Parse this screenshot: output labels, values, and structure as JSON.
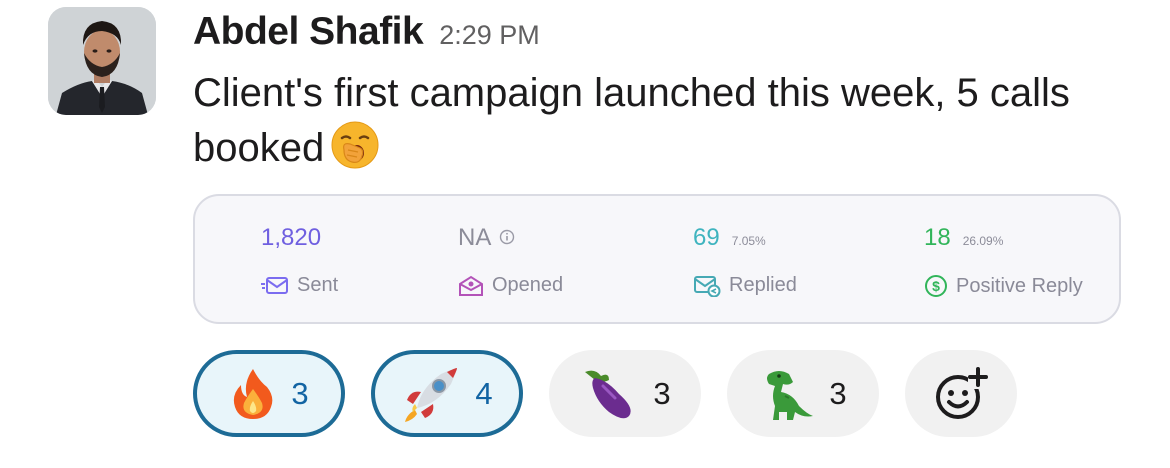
{
  "message": {
    "author": "Abdel Shafik",
    "time": "2:29 PM",
    "text": "Client's first campaign launched this week, 5 calls booked",
    "inline_emoji": "yawning-face-emoji"
  },
  "stats_card": {
    "sent": {
      "value": "1,820",
      "label": "Sent",
      "color": "#6f5fe0",
      "icon": "envelope-icon"
    },
    "opened": {
      "value": "NA",
      "label": "Opened",
      "color": "#8c8c99",
      "icon": "open-envelope-icon",
      "info_icon": "info-icon"
    },
    "replied": {
      "value": "69",
      "percent": "7.05%",
      "label": "Replied",
      "color": "#3fb4bf",
      "icon": "reply-envelope-icon"
    },
    "positive": {
      "value": "18",
      "percent": "26.09%",
      "label": "Positive Reply",
      "color": "#31b55a",
      "icon": "dollar-circle-icon"
    }
  },
  "reactions": [
    {
      "emoji": "fire-emoji",
      "count": "3",
      "active": true
    },
    {
      "emoji": "rocket-emoji",
      "count": "4",
      "active": true
    },
    {
      "emoji": "eggplant-emoji",
      "count": "3",
      "active": false
    },
    {
      "emoji": "t-rex-emoji",
      "count": "3",
      "active": false
    }
  ],
  "add_reaction_icon": "add-reaction-icon",
  "colors": {
    "active_border": "#1d6b96",
    "active_bg": "#e8f5fa",
    "inactive_bg": "#f1f1f1"
  }
}
